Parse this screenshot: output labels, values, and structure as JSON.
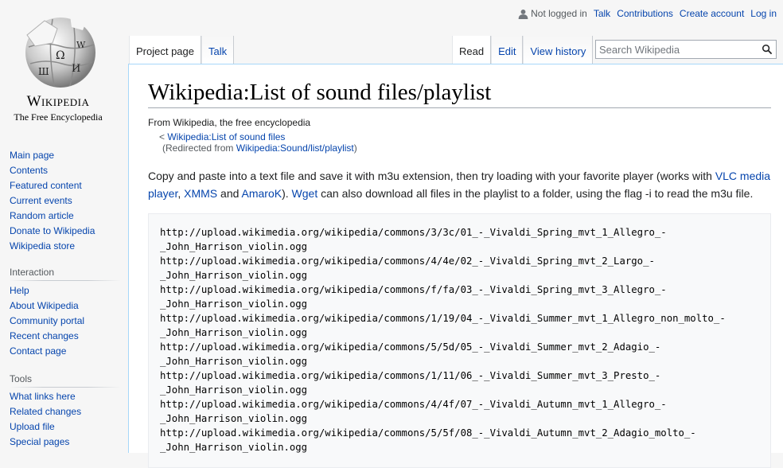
{
  "logo": {
    "wordmark": "Wikipedia",
    "tagline": "The Free Encyclopedia"
  },
  "personal": {
    "not_logged_in": "Not logged in",
    "links": [
      "Talk",
      "Contributions",
      "Create account",
      "Log in"
    ]
  },
  "tabs_left": [
    "Project page",
    "Talk"
  ],
  "tabs_right": [
    "Read",
    "Edit",
    "View history"
  ],
  "search": {
    "placeholder": "Search Wikipedia"
  },
  "sidebar": {
    "navigation": [
      "Main page",
      "Contents",
      "Featured content",
      "Current events",
      "Random article",
      "Donate to Wikipedia",
      "Wikipedia store"
    ],
    "interaction_heading": "Interaction",
    "interaction": [
      "Help",
      "About Wikipedia",
      "Community portal",
      "Recent changes",
      "Contact page"
    ],
    "tools_heading": "Tools",
    "tools": [
      "What links here",
      "Related changes",
      "Upload file",
      "Special pages"
    ]
  },
  "page": {
    "title": "Wikipedia:List of sound files/playlist",
    "sitesub": "From Wikipedia, the free encyclopedia",
    "backlink_prefix": "< ",
    "backlink": "Wikipedia:List of sound files",
    "redirect_prefix": "(Redirected from ",
    "redirect_link": "Wikipedia:Sound/list/playlist",
    "redirect_suffix": ")",
    "intro": {
      "t1": "Copy and paste into a text file and save it with m3u extension, then try loading with your favorite player (works with ",
      "vlc": "VLC media player",
      "t2": ", ",
      "xmms": "XMMS",
      "t3": " and ",
      "amarok": "AmaroK",
      "t4": "). ",
      "wget": "Wget",
      "t5": " can also download all files in the playlist to a folder, using the flag -i to read the m3u file."
    },
    "playlist": [
      "http://upload.wikimedia.org/wikipedia/commons/3/3c/01_-_Vivaldi_Spring_mvt_1_Allegro_-",
      "_John_Harrison_violin.ogg",
      "http://upload.wikimedia.org/wikipedia/commons/4/4e/02_-_Vivaldi_Spring_mvt_2_Largo_-",
      "_John_Harrison_violin.ogg",
      "http://upload.wikimedia.org/wikipedia/commons/f/fa/03_-_Vivaldi_Spring_mvt_3_Allegro_-",
      "_John_Harrison_violin.ogg",
      "http://upload.wikimedia.org/wikipedia/commons/1/19/04_-_Vivaldi_Summer_mvt_1_Allegro_non_molto_-",
      "_John_Harrison_violin.ogg",
      "http://upload.wikimedia.org/wikipedia/commons/5/5d/05_-_Vivaldi_Summer_mvt_2_Adagio_-",
      "_John_Harrison_violin.ogg",
      "http://upload.wikimedia.org/wikipedia/commons/1/11/06_-_Vivaldi_Summer_mvt_3_Presto_-",
      "_John_Harrison_violin.ogg",
      "http://upload.wikimedia.org/wikipedia/commons/4/4f/07_-_Vivaldi_Autumn_mvt_1_Allegro_-",
      "_John_Harrison_violin.ogg",
      "http://upload.wikimedia.org/wikipedia/commons/5/5f/08_-_Vivaldi_Autumn_mvt_2_Adagio_molto_-",
      "_John_Harrison_violin.ogg"
    ]
  }
}
